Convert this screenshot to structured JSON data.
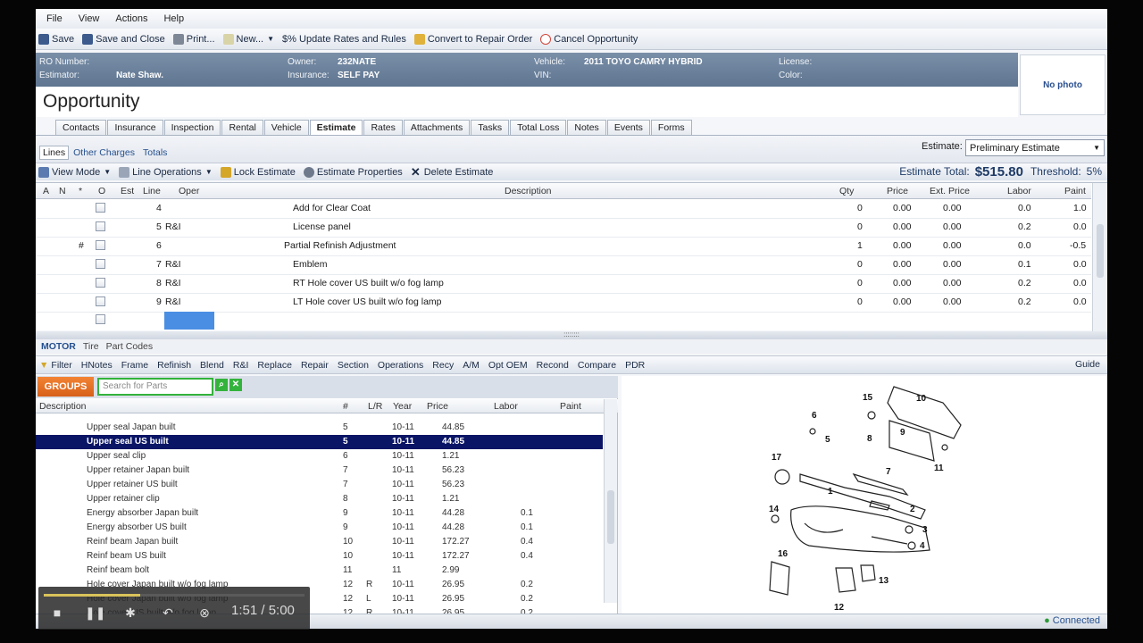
{
  "menu": [
    "File",
    "View",
    "Actions",
    "Help"
  ],
  "toolbar": [
    {
      "label": "Save",
      "icon": "save-icon"
    },
    {
      "label": "Save and Close",
      "icon": "save-close-icon"
    },
    {
      "label": "Print...",
      "icon": "print-icon"
    },
    {
      "label": "New...",
      "icon": "new-icon"
    },
    {
      "label": "$% Update Rates and Rules",
      "icon": "rates-icon"
    },
    {
      "label": "Convert to Repair Order",
      "icon": "convert-icon"
    },
    {
      "label": "Cancel Opportunity",
      "icon": "cancel-icon"
    }
  ],
  "info": {
    "ro_label": "RO Number:",
    "ro_value": "",
    "estimator_label": "Estimator:",
    "estimator_value": "Nate Shaw.",
    "owner_label": "Owner:",
    "owner_value": "232NATE",
    "insurance_label": "Insurance:",
    "insurance_value": "SELF PAY",
    "vehicle_label": "Vehicle:",
    "vehicle_value": "2011 TOYO CAMRY HYBRID",
    "vin_label": "VIN:",
    "vin_value": "",
    "license_label": "License:",
    "license_value": "",
    "color_label": "Color:",
    "color_value": "",
    "photo": "No photo"
  },
  "page_title": "Opportunity",
  "tabs": [
    "Contacts",
    "Insurance",
    "Inspection",
    "Rental",
    "Vehicle",
    "Estimate",
    "Rates",
    "Attachments",
    "Tasks",
    "Total Loss",
    "Notes",
    "Events",
    "Forms"
  ],
  "selected_tab": "Estimate",
  "subtabs": [
    "Lines",
    "Other Charges",
    "Totals"
  ],
  "estimate_label": "Estimate:",
  "estimate_select": "Preliminary Estimate",
  "lines_toolbar": [
    "View Mode",
    "Line Operations",
    "Lock Estimate",
    "Estimate Properties",
    "Delete Estimate"
  ],
  "estimate_total_label": "Estimate Total:",
  "estimate_total": "$515.80",
  "threshold_label": "Threshold:",
  "threshold": "5%",
  "line_columns": [
    "A",
    "N",
    "*",
    "O",
    "Est",
    "Line",
    "Oper",
    "Description",
    "Qty",
    "Price",
    "Ext. Price",
    "Labor",
    "Paint"
  ],
  "lines": [
    {
      "mark": "",
      "line": "4",
      "oper": "",
      "desc": "Add for Clear Coat",
      "qty": "0",
      "price": "0.00",
      "ext": "0.00",
      "labor": "0.0",
      "paint": "1.0"
    },
    {
      "mark": "",
      "line": "5",
      "oper": "R&I",
      "desc": "License panel",
      "qty": "0",
      "price": "0.00",
      "ext": "0.00",
      "labor": "0.2",
      "paint": "0.0"
    },
    {
      "mark": "#",
      "line": "6",
      "oper": "",
      "desc": "Partial Refinish Adjustment",
      "qty": "1",
      "price": "0.00",
      "ext": "0.00",
      "labor": "0.0",
      "paint": "-0.5"
    },
    {
      "mark": "",
      "line": "7",
      "oper": "R&I",
      "desc": "Emblem",
      "qty": "0",
      "price": "0.00",
      "ext": "0.00",
      "labor": "0.1",
      "paint": "0.0"
    },
    {
      "mark": "",
      "line": "8",
      "oper": "R&I",
      "desc": "RT Hole cover US built w/o fog lamp",
      "qty": "0",
      "price": "0.00",
      "ext": "0.00",
      "labor": "0.2",
      "paint": "0.0"
    },
    {
      "mark": "",
      "line": "9",
      "oper": "R&I",
      "desc": "LT Hole cover US built w/o fog lamp",
      "qty": "0",
      "price": "0.00",
      "ext": "0.00",
      "labor": "0.2",
      "paint": "0.0"
    }
  ],
  "motor_tabs": [
    "MOTOR",
    "Tire",
    "Part Codes"
  ],
  "filter_bar": [
    "Filter",
    "HNotes",
    "Frame",
    "Refinish",
    "Blend",
    "R&I",
    "Replace",
    "Repair",
    "Section",
    "Operations",
    "Recy",
    "A/M",
    "Opt OEM",
    "Recond",
    "Compare",
    "PDR"
  ],
  "guide": "Guide",
  "groups_label": "GROUPS",
  "search_placeholder": "Search for Parts",
  "parts_columns": [
    "Description",
    "#",
    "L/R",
    "Year",
    "Price",
    "Labor",
    "Paint"
  ],
  "parts": [
    {
      "desc": "Upper seal Japan built",
      "num": "5",
      "lr": "",
      "year": "10-11",
      "price": "44.85",
      "labor": "",
      "paint": ""
    },
    {
      "desc": "Upper seal US built",
      "num": "5",
      "lr": "",
      "year": "10-11",
      "price": "44.85",
      "labor": "",
      "paint": ""
    },
    {
      "desc": "Upper seal clip",
      "num": "6",
      "lr": "",
      "year": "10-11",
      "price": "1.21",
      "labor": "",
      "paint": ""
    },
    {
      "desc": "Upper retainer Japan built",
      "num": "7",
      "lr": "",
      "year": "10-11",
      "price": "56.23",
      "labor": "",
      "paint": ""
    },
    {
      "desc": "Upper retainer US built",
      "num": "7",
      "lr": "",
      "year": "10-11",
      "price": "56.23",
      "labor": "",
      "paint": ""
    },
    {
      "desc": "Upper retainer clip",
      "num": "8",
      "lr": "",
      "year": "10-11",
      "price": "1.21",
      "labor": "",
      "paint": ""
    },
    {
      "desc": "Energy absorber Japan built",
      "num": "9",
      "lr": "",
      "year": "10-11",
      "price": "44.28",
      "labor": "0.1",
      "paint": ""
    },
    {
      "desc": "Energy absorber US built",
      "num": "9",
      "lr": "",
      "year": "10-11",
      "price": "44.28",
      "labor": "0.1",
      "paint": ""
    },
    {
      "desc": "Reinf beam Japan built",
      "num": "10",
      "lr": "",
      "year": "10-11",
      "price": "172.27",
      "labor": "0.4",
      "paint": ""
    },
    {
      "desc": "Reinf beam US built",
      "num": "10",
      "lr": "",
      "year": "10-11",
      "price": "172.27",
      "labor": "0.4",
      "paint": ""
    },
    {
      "desc": "Reinf beam bolt",
      "num": "11",
      "lr": "",
      "year": "11",
      "price": "2.99",
      "labor": "",
      "paint": ""
    },
    {
      "desc": "Hole cover Japan built w/o fog lamp",
      "num": "12",
      "lr": "R",
      "year": "10-11",
      "price": "26.95",
      "labor": "0.2",
      "paint": ""
    },
    {
      "desc": "Hole cover Japan built w/o fog lamp",
      "num": "12",
      "lr": "L",
      "year": "10-11",
      "price": "26.95",
      "labor": "0.2",
      "paint": ""
    },
    {
      "desc": "Hole cover US built w/o fog lamp",
      "num": "12",
      "lr": "R",
      "year": "10-11",
      "price": "26.95",
      "labor": "0.2",
      "paint": ""
    }
  ],
  "diagram_callouts": [
    "1",
    "2",
    "3",
    "4",
    "5",
    "6",
    "7",
    "8",
    "9",
    "10",
    "11",
    "12",
    "13",
    "14",
    "15",
    "16",
    "17"
  ],
  "status": "Connected",
  "media": {
    "time": "1:51 / 5:00",
    "progress": 0.37
  }
}
